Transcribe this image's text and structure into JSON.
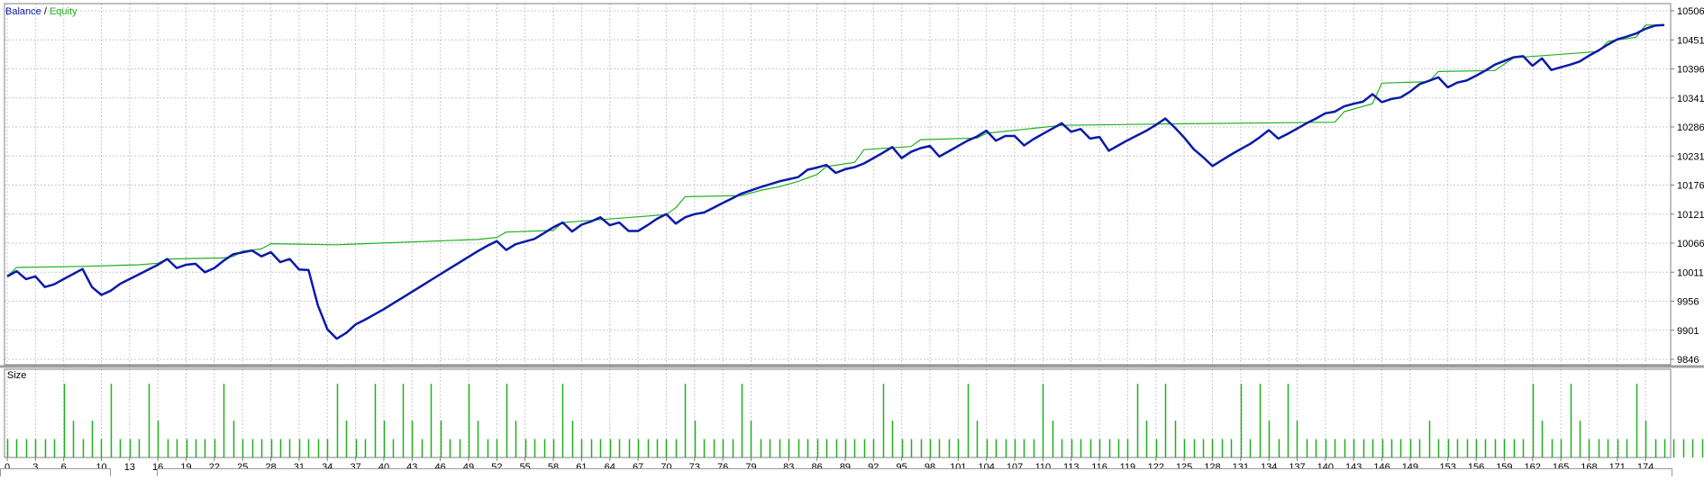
{
  "legend": {
    "balance": "Balance",
    "separator": " / ",
    "equity": "Equity"
  },
  "volume_panel": {
    "label": "Size"
  },
  "colors": {
    "balance": "#0a1aa8",
    "equity": "#1fb01f",
    "volume": "#1fb01f",
    "grid": "#c8c8c8",
    "axis": "#808080",
    "text": "#000000"
  },
  "chart_data": [
    {
      "type": "line",
      "legend_position": "top-left",
      "grid": true,
      "ylim": [
        9846,
        10506
      ],
      "y_ticks": [
        9846,
        9901,
        9956,
        10011,
        10066,
        10121,
        10176,
        10231,
        10286,
        10341,
        10396,
        10451,
        10506
      ],
      "xlim": [
        0,
        176
      ],
      "x_ticks": [
        0,
        3,
        6,
        10,
        13,
        16,
        19,
        22,
        25,
        28,
        31,
        34,
        37,
        40,
        43,
        46,
        49,
        52,
        55,
        58,
        61,
        64,
        67,
        70,
        73,
        76,
        79,
        83,
        86,
        89,
        92,
        95,
        98,
        101,
        104,
        107,
        110,
        113,
        116,
        119,
        122,
        125,
        128,
        131,
        134,
        137,
        140,
        143,
        146,
        149,
        153,
        156,
        159,
        162,
        165,
        168,
        171,
        174
      ],
      "series": [
        {
          "name": "Balance",
          "points": [
            [
              0,
              10003
            ],
            [
              1,
              10013
            ],
            [
              2,
              9998
            ],
            [
              3,
              10003
            ],
            [
              4,
              9983
            ],
            [
              5,
              9988
            ],
            [
              6,
              9998
            ],
            [
              8,
              10017
            ],
            [
              9,
              9983
            ],
            [
              10,
              9968
            ],
            [
              11,
              9976
            ],
            [
              12,
              9989
            ],
            [
              13,
              9998
            ],
            [
              14,
              10007
            ],
            [
              16,
              10025
            ],
            [
              17,
              10036
            ],
            [
              18,
              10019
            ],
            [
              19,
              10025
            ],
            [
              20,
              10027
            ],
            [
              21,
              10011
            ],
            [
              22,
              10019
            ],
            [
              23,
              10033
            ],
            [
              24,
              10045
            ],
            [
              26,
              10052
            ],
            [
              27,
              10041
            ],
            [
              28,
              10049
            ],
            [
              29,
              10030
            ],
            [
              30,
              10036
            ],
            [
              31,
              10016
            ],
            [
              32,
              10015
            ],
            [
              33,
              9948
            ],
            [
              34,
              9903
            ],
            [
              35,
              9885
            ],
            [
              36,
              9896
            ],
            [
              37,
              9912
            ],
            [
              38,
              9921
            ],
            [
              39,
              9931
            ],
            [
              40,
              9941
            ],
            [
              41,
              9952
            ],
            [
              42,
              9963
            ],
            [
              43,
              9974
            ],
            [
              44,
              9985
            ],
            [
              45,
              9996
            ],
            [
              46,
              10007
            ],
            [
              47,
              10018
            ],
            [
              48,
              10029
            ],
            [
              49,
              10040
            ],
            [
              50,
              10051
            ],
            [
              51,
              10061
            ],
            [
              52,
              10070
            ],
            [
              53,
              10053
            ],
            [
              54,
              10064
            ],
            [
              55,
              10069
            ],
            [
              56,
              10074
            ],
            [
              57,
              10085
            ],
            [
              58,
              10096
            ],
            [
              59,
              10105
            ],
            [
              60,
              10088
            ],
            [
              61,
              10101
            ],
            [
              62,
              10107
            ],
            [
              63,
              10115
            ],
            [
              64,
              10100
            ],
            [
              65,
              10105
            ],
            [
              66,
              10089
            ],
            [
              67,
              10089
            ],
            [
              68,
              10100
            ],
            [
              69,
              10112
            ],
            [
              70,
              10121
            ],
            [
              71,
              10103
            ],
            [
              72,
              10115
            ],
            [
              73,
              10121
            ],
            [
              74,
              10124
            ],
            [
              75,
              10133
            ],
            [
              76,
              10142
            ],
            [
              77,
              10151
            ],
            [
              78,
              10160
            ],
            [
              80,
              10172
            ],
            [
              82,
              10183
            ],
            [
              84,
              10191
            ],
            [
              85,
              10205
            ],
            [
              86,
              10209
            ],
            [
              87,
              10214
            ],
            [
              88,
              10199
            ],
            [
              89,
              10206
            ],
            [
              90,
              10210
            ],
            [
              91,
              10217
            ],
            [
              92,
              10227
            ],
            [
              93,
              10237
            ],
            [
              94,
              10248
            ],
            [
              95,
              10227
            ],
            [
              96,
              10239
            ],
            [
              97,
              10246
            ],
            [
              98,
              10250
            ],
            [
              99,
              10230
            ],
            [
              100,
              10240
            ],
            [
              101,
              10250
            ],
            [
              102,
              10260
            ],
            [
              103,
              10268
            ],
            [
              104,
              10279
            ],
            [
              105,
              10260
            ],
            [
              106,
              10269
            ],
            [
              107,
              10269
            ],
            [
              108,
              10251
            ],
            [
              109,
              10263
            ],
            [
              110,
              10273
            ],
            [
              111,
              10283
            ],
            [
              112,
              10293
            ],
            [
              113,
              10277
            ],
            [
              114,
              10282
            ],
            [
              115,
              10264
            ],
            [
              116,
              10267
            ],
            [
              117,
              10241
            ],
            [
              118,
              10251
            ],
            [
              119,
              10261
            ],
            [
              120,
              10270
            ],
            [
              121,
              10279
            ],
            [
              122,
              10290
            ],
            [
              123,
              10302
            ],
            [
              124,
              10285
            ],
            [
              125,
              10266
            ],
            [
              126,
              10244
            ],
            [
              127,
              10229
            ],
            [
              128,
              10212
            ],
            [
              129,
              10223
            ],
            [
              130,
              10234
            ],
            [
              131,
              10244
            ],
            [
              132,
              10254
            ],
            [
              133,
              10266
            ],
            [
              134,
              10280
            ],
            [
              135,
              10264
            ],
            [
              136,
              10273
            ],
            [
              137,
              10283
            ],
            [
              138,
              10293
            ],
            [
              139,
              10302
            ],
            [
              140,
              10312
            ],
            [
              141,
              10315
            ],
            [
              142,
              10325
            ],
            [
              143,
              10330
            ],
            [
              144,
              10334
            ],
            [
              145,
              10348
            ],
            [
              146,
              10333
            ],
            [
              147,
              10339
            ],
            [
              148,
              10342
            ],
            [
              149,
              10353
            ],
            [
              150,
              10367
            ],
            [
              152,
              10380
            ],
            [
              153,
              10361
            ],
            [
              154,
              10370
            ],
            [
              155,
              10374
            ],
            [
              156,
              10383
            ],
            [
              157,
              10393
            ],
            [
              158,
              10404
            ],
            [
              160,
              10418
            ],
            [
              161,
              10420
            ],
            [
              162,
              10402
            ],
            [
              163,
              10416
            ],
            [
              164,
              10394
            ],
            [
              165,
              10399
            ],
            [
              166,
              10404
            ],
            [
              167,
              10410
            ],
            [
              168,
              10421
            ],
            [
              169,
              10431
            ],
            [
              170,
              10442
            ],
            [
              171,
              10452
            ],
            [
              172,
              10457
            ],
            [
              173,
              10463
            ],
            [
              174,
              10472
            ],
            [
              175,
              10478
            ],
            [
              176,
              10479
            ]
          ]
        },
        {
          "name": "Equity",
          "points": [
            [
              0,
              10003
            ],
            [
              1,
              10020
            ],
            [
              8,
              10022
            ],
            [
              14,
              10025
            ],
            [
              16,
              10028
            ],
            [
              17,
              10036
            ],
            [
              23,
              10038
            ],
            [
              24,
              10041
            ],
            [
              25,
              10051
            ],
            [
              27,
              10055
            ],
            [
              28,
              10065
            ],
            [
              35,
              10063
            ],
            [
              50,
              10073
            ],
            [
              52,
              10077
            ],
            [
              53,
              10087
            ],
            [
              58,
              10090
            ],
            [
              59,
              10105
            ],
            [
              70,
              10120
            ],
            [
              71,
              10133
            ],
            [
              72,
              10154
            ],
            [
              78,
              10156
            ],
            [
              80,
              10166
            ],
            [
              82,
              10173
            ],
            [
              84,
              10183
            ],
            [
              86,
              10196
            ],
            [
              87,
              10211
            ],
            [
              90,
              10219
            ],
            [
              91,
              10243
            ],
            [
              96,
              10249
            ],
            [
              97,
              10262
            ],
            [
              103,
              10265
            ],
            [
              104,
              10274
            ],
            [
              112,
              10289
            ],
            [
              124,
              10292
            ],
            [
              141,
              10295
            ],
            [
              142,
              10315
            ],
            [
              145,
              10330
            ],
            [
              146,
              10369
            ],
            [
              151,
              10372
            ],
            [
              152,
              10391
            ],
            [
              158,
              10393
            ],
            [
              160,
              10417
            ],
            [
              169,
              10429
            ],
            [
              170,
              10448
            ],
            [
              173,
              10456
            ],
            [
              174,
              10479
            ],
            [
              176,
              10479
            ]
          ]
        }
      ]
    },
    {
      "type": "bar",
      "title": "Size",
      "xlim": [
        0,
        176
      ],
      "values": [
        1,
        1,
        1,
        1,
        1,
        1,
        4,
        2,
        1,
        2,
        1,
        4,
        1,
        1,
        1,
        4,
        2,
        1,
        1,
        1,
        1,
        1,
        1,
        4,
        2,
        1,
        1,
        1,
        1,
        1,
        1,
        1,
        1,
        1,
        1,
        4,
        2,
        1,
        1,
        4,
        2,
        1,
        4,
        2,
        1,
        4,
        2,
        1,
        1,
        4,
        2,
        1,
        1,
        4,
        2,
        1,
        1,
        1,
        1,
        4,
        2,
        1,
        1,
        1,
        1,
        1,
        1,
        1,
        1,
        1,
        1,
        1,
        4,
        2,
        1,
        1,
        1,
        1,
        4,
        2,
        1,
        1,
        1,
        1,
        1,
        1,
        1,
        1,
        1,
        1,
        1,
        1,
        1,
        4,
        2,
        1,
        1,
        1,
        1,
        1,
        1,
        1,
        4,
        2,
        1,
        1,
        1,
        1,
        1,
        1,
        4,
        2,
        1,
        1,
        1,
        1,
        1,
        1,
        1,
        1,
        4,
        2,
        1,
        4,
        2,
        1,
        1,
        1,
        1,
        1,
        1,
        4,
        1,
        4,
        2,
        1,
        4,
        2,
        1,
        1,
        1,
        1,
        1,
        1,
        1,
        1,
        1,
        1,
        1,
        1,
        1,
        2,
        1,
        1,
        1,
        1,
        1,
        1,
        1,
        1,
        1,
        1,
        4,
        2,
        1,
        1,
        4,
        2,
        1,
        1,
        1,
        1,
        1,
        4,
        2,
        1,
        1,
        1,
        1,
        1,
        1,
        1
      ]
    }
  ]
}
